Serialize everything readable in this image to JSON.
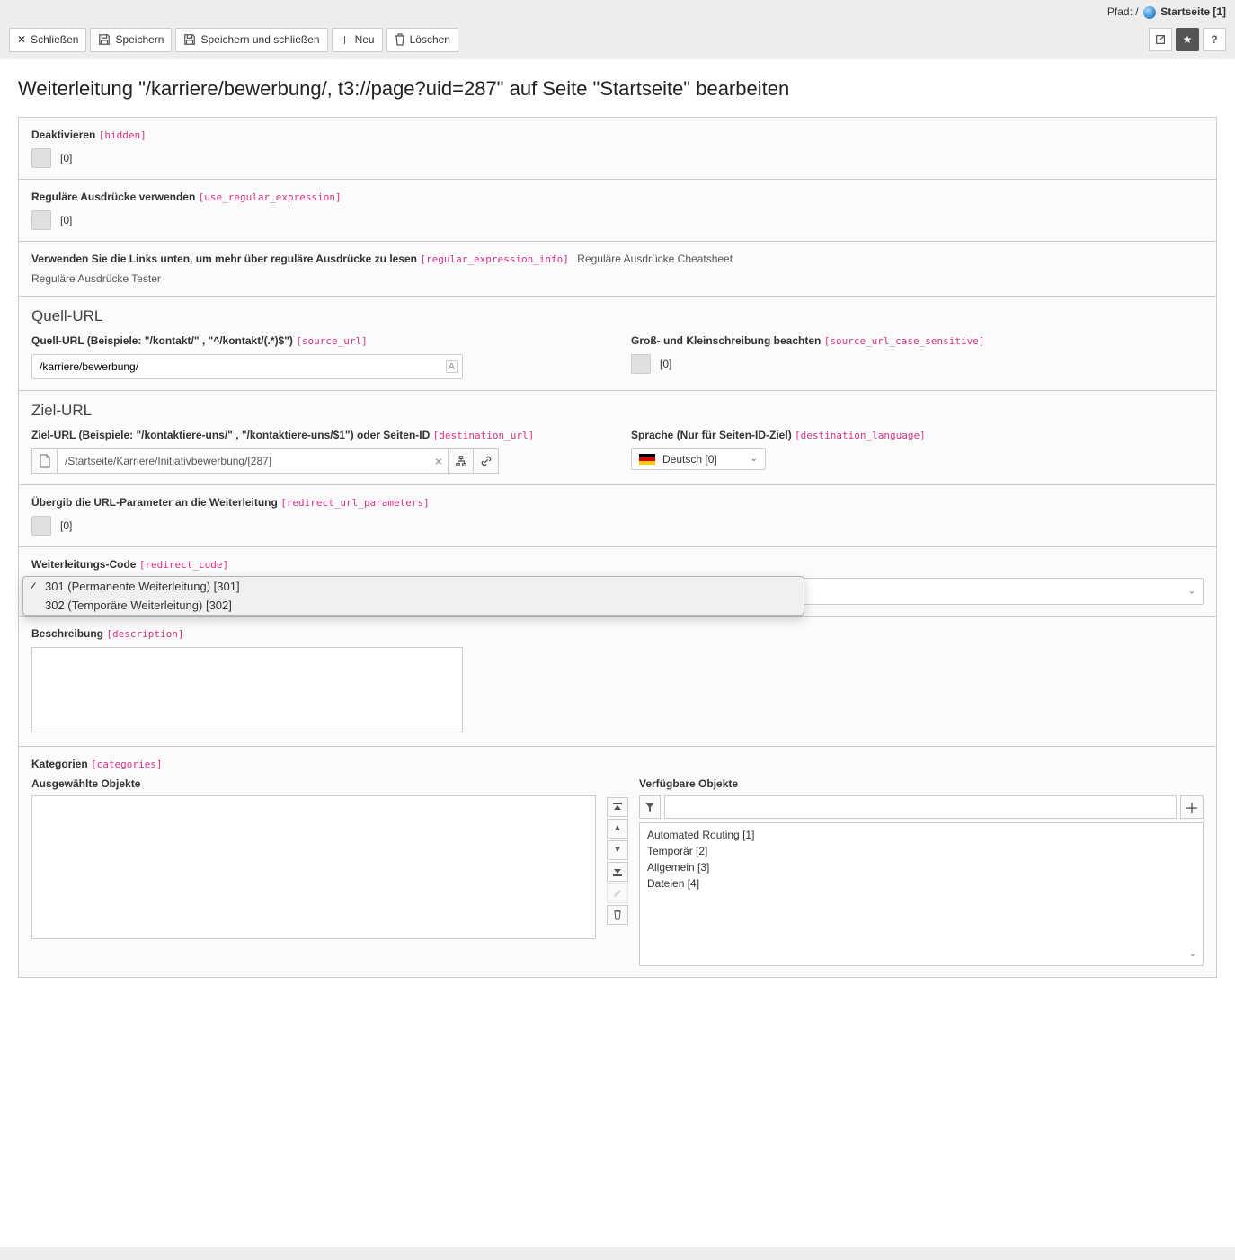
{
  "path": {
    "label": "Pfad:",
    "sep": "/",
    "start": "Startseite [1]"
  },
  "toolbar": {
    "close": "Schließen",
    "save": "Speichern",
    "saveClose": "Speichern und schließen",
    "new": "Neu",
    "delete": "Löschen"
  },
  "title": "Weiterleitung \"/karriere/bewerbung/, t3://page?uid=287\" auf Seite \"Startseite\" bearbeiten",
  "fields": {
    "deactivate": {
      "label": "Deaktivieren",
      "tech": "[hidden]",
      "val": "[0]"
    },
    "regex": {
      "label": "Reguläre Ausdrücke verwenden",
      "tech": "[use_regular_expression]",
      "val": "[0]"
    },
    "regexInfo": {
      "label": "Verwenden Sie die Links unten, um mehr über reguläre Ausdrücke zu lesen",
      "tech": "[regular_expression_info]",
      "link1": "Reguläre Ausdrücke Cheatsheet",
      "link2": "Reguläre Ausdrücke Tester"
    },
    "sourceSection": "Quell-URL",
    "source": {
      "label": "Quell-URL (Beispiele: \"/kontakt/\" , \"^/kontakt/(.*)$\")",
      "tech": "[source_url]",
      "val": "/karriere/bewerbung/"
    },
    "caseSensitive": {
      "label": "Groß- und Kleinschreibung beachten",
      "tech": "[source_url_case_sensitive]",
      "val": "[0]"
    },
    "destSection": "Ziel-URL",
    "dest": {
      "label": "Ziel-URL (Beispiele: \"/kontaktiere-uns/\" , \"/kontaktiere-uns/$1\") oder Seiten-ID",
      "tech": "[destination_url]",
      "val": "/Startseite/Karriere/Initiativbewerbung/[287]"
    },
    "lang": {
      "label": "Sprache (Nur für Seiten-ID-Ziel)",
      "tech": "[destination_language]",
      "val": "Deutsch [0]"
    },
    "passParams": {
      "label": "Übergib die URL-Parameter an die Weiterleitung",
      "tech": "[redirect_url_parameters]",
      "val": "[0]"
    },
    "code": {
      "label": "Weiterleitungs-Code",
      "tech": "[redirect_code]",
      "opt1": "301 (Permanente Weiterleitung) [301]",
      "opt2": "302 (Temporäre Weiterleitung) [302]"
    },
    "desc": {
      "label": "Beschreibung",
      "tech": "[description]"
    },
    "cat": {
      "label": "Kategorien",
      "tech": "[categories]",
      "selectedLabel": "Ausgewählte Objekte",
      "availableLabel": "Verfügbare Objekte",
      "items": {
        "i1": "Automated Routing [1]",
        "i2": "Temporär [2]",
        "i3": "Allgemein [3]",
        "i4": "Dateien [4]"
      }
    }
  }
}
